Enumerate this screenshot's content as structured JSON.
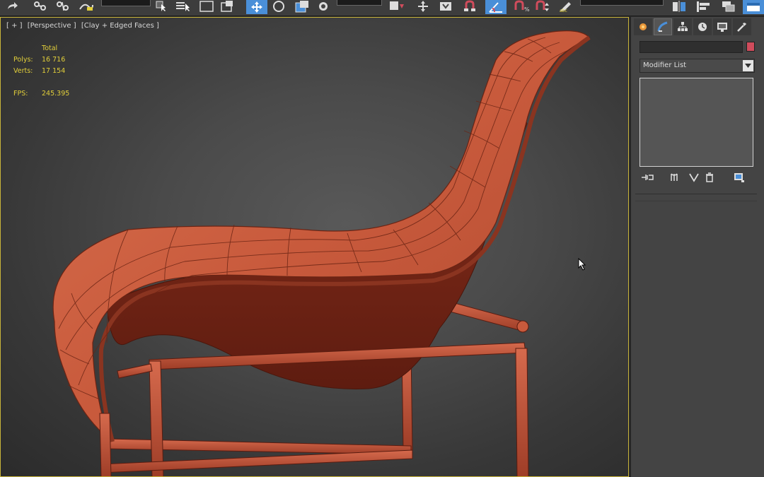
{
  "toolbar": {
    "buttons": [
      {
        "name": "redo-icon"
      },
      {
        "name": "select-link-icon"
      },
      {
        "name": "unlink-icon"
      },
      {
        "name": "bind-spacewarp-icon"
      },
      {
        "name": "selection-filter-dropdown"
      },
      {
        "name": "select-object-icon"
      },
      {
        "name": "select-by-name-icon"
      },
      {
        "name": "rect-selection-icon"
      },
      {
        "name": "window-crossing-icon"
      },
      {
        "name": "select-move-icon"
      },
      {
        "name": "select-rotate-icon"
      },
      {
        "name": "select-scale-icon"
      },
      {
        "name": "placement-icon"
      },
      {
        "name": "reference-coord-dropdown"
      },
      {
        "name": "pivot-center-icon"
      },
      {
        "name": "manipulate-icon"
      },
      {
        "name": "keyboard-shortcut-icon"
      },
      {
        "name": "snaps-toggle-icon"
      },
      {
        "name": "angle-snap-icon"
      },
      {
        "name": "percent-snap-icon"
      },
      {
        "name": "spinner-snap-icon"
      },
      {
        "name": "edit-named-selection-icon"
      },
      {
        "name": "named-selection-dropdown"
      },
      {
        "name": "mirror-icon"
      },
      {
        "name": "align-icon"
      },
      {
        "name": "layer-explorer-icon"
      },
      {
        "name": "toggle-ribbon-icon"
      }
    ]
  },
  "viewport": {
    "labels": [
      "[ + ]",
      "[Perspective ]",
      "[Clay + Edged Faces ]"
    ],
    "stats": {
      "header": "Total",
      "polys_label": "Polys:",
      "polys_value": "16 716",
      "verts_label": "Verts:",
      "verts_value": "17 154",
      "fps_label": "FPS:",
      "fps_value": "245.395"
    },
    "colors": {
      "stats_text": "#e2cf3a",
      "border": "#c8b43a",
      "model": "#c85a3c"
    }
  },
  "command_panel": {
    "tabs": [
      {
        "name": "create-tab-icon"
      },
      {
        "name": "modify-tab-icon"
      },
      {
        "name": "hierarchy-tab-icon"
      },
      {
        "name": "motion-tab-icon"
      },
      {
        "name": "display-tab-icon"
      },
      {
        "name": "utilities-tab-icon"
      }
    ],
    "object_name": "",
    "object_color": "#d04c5c",
    "modifier_list": {
      "selected": "Modifier List"
    },
    "stack_tools": [
      {
        "name": "pin-stack-icon"
      },
      {
        "name": "show-end-result-icon"
      },
      {
        "name": "make-unique-icon"
      },
      {
        "name": "remove-modifier-icon"
      },
      {
        "name": "configure-modifier-sets-icon"
      }
    ]
  }
}
